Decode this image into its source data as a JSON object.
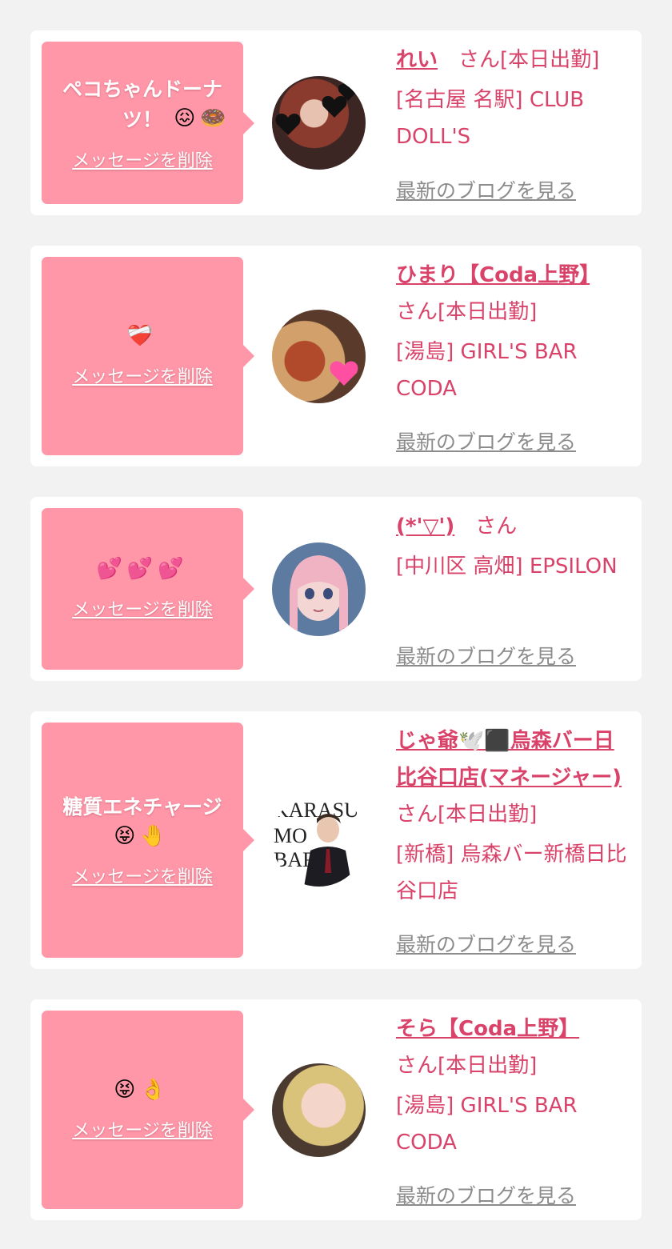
{
  "colors": {
    "bubble": "#ff97a8",
    "accent": "#d9436a",
    "link_gray": "#8c8c8c",
    "background": "#f2f2f2"
  },
  "common": {
    "delete_label": "メッセージを削除",
    "blog_label": "最新のブログを見る"
  },
  "cards": [
    {
      "message": "ペコちゃんドーナツ！",
      "emoji": "😖🍩",
      "name": "れい",
      "suffix": "　さん[本日出勤]",
      "area": "[名古屋 名駅] CLUB DOLL'S"
    },
    {
      "message": "",
      "emoji": "❤️‍🩹",
      "name": "ひまり【Coda上野】",
      "suffix": "　さん[本日出勤]",
      "area": "[湯島] GIRL'S BAR CODA"
    },
    {
      "message": "",
      "emoji": "💕💕💕",
      "name": "(*'▽')",
      "suffix": "　さん",
      "area": "[中川区 高畑] EPSILON"
    },
    {
      "message": "糖質エネチャージ",
      "emoji": "😝🤚",
      "name": "じゃ爺🕊️⬛烏森バー日比谷口店(マネージャー)",
      "suffix": "　さん[本日出勤]",
      "area": "[新橋] 烏森バー新橋日比谷口店"
    },
    {
      "message": "",
      "emoji": "😝👌",
      "name": "そら【Coda上野】",
      "suffix": "さん[本日出勤]",
      "area": "[湯島] GIRL'S BAR CODA"
    }
  ]
}
